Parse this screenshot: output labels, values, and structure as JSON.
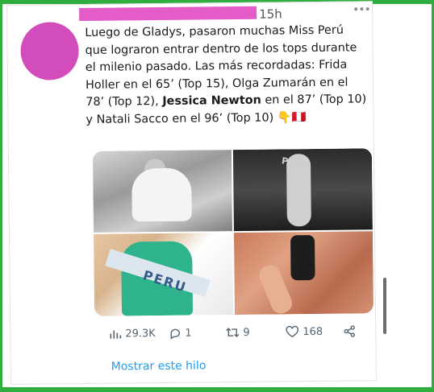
{
  "tweet": {
    "timestamp": "15h",
    "text_parts": {
      "p1": "Luego de Gladys, pasaron muchas Miss Perú que lograron entrar dentro de los tops durante el milenio pasado. Las más recordadas: Frida Holler en el 65’ (Top 15), Olga Zumarán en el 78’ (Top 12), ",
      "bold": "Jessica Newton",
      "p2": " en el 87’ (Top 10) y Natali Sacco en el 96’ (Top 10) ",
      "emoji": "👇🇵🇪"
    },
    "media_sash_text": "PERU",
    "media_sash_text_small": "PERU"
  },
  "actions": {
    "views": "29.3K",
    "replies": "1",
    "retweets": "9",
    "likes": "168"
  },
  "thread_link": "Mostrar este hilo",
  "colors": {
    "frame": "#2fae3f",
    "avatar": "#d24dbb",
    "redaction": "#e35cc8",
    "link": "#1d9bf0",
    "icon": "#536471"
  },
  "icons": [
    "more-icon",
    "views-icon",
    "reply-icon",
    "retweet-icon",
    "like-icon",
    "share-icon"
  ]
}
